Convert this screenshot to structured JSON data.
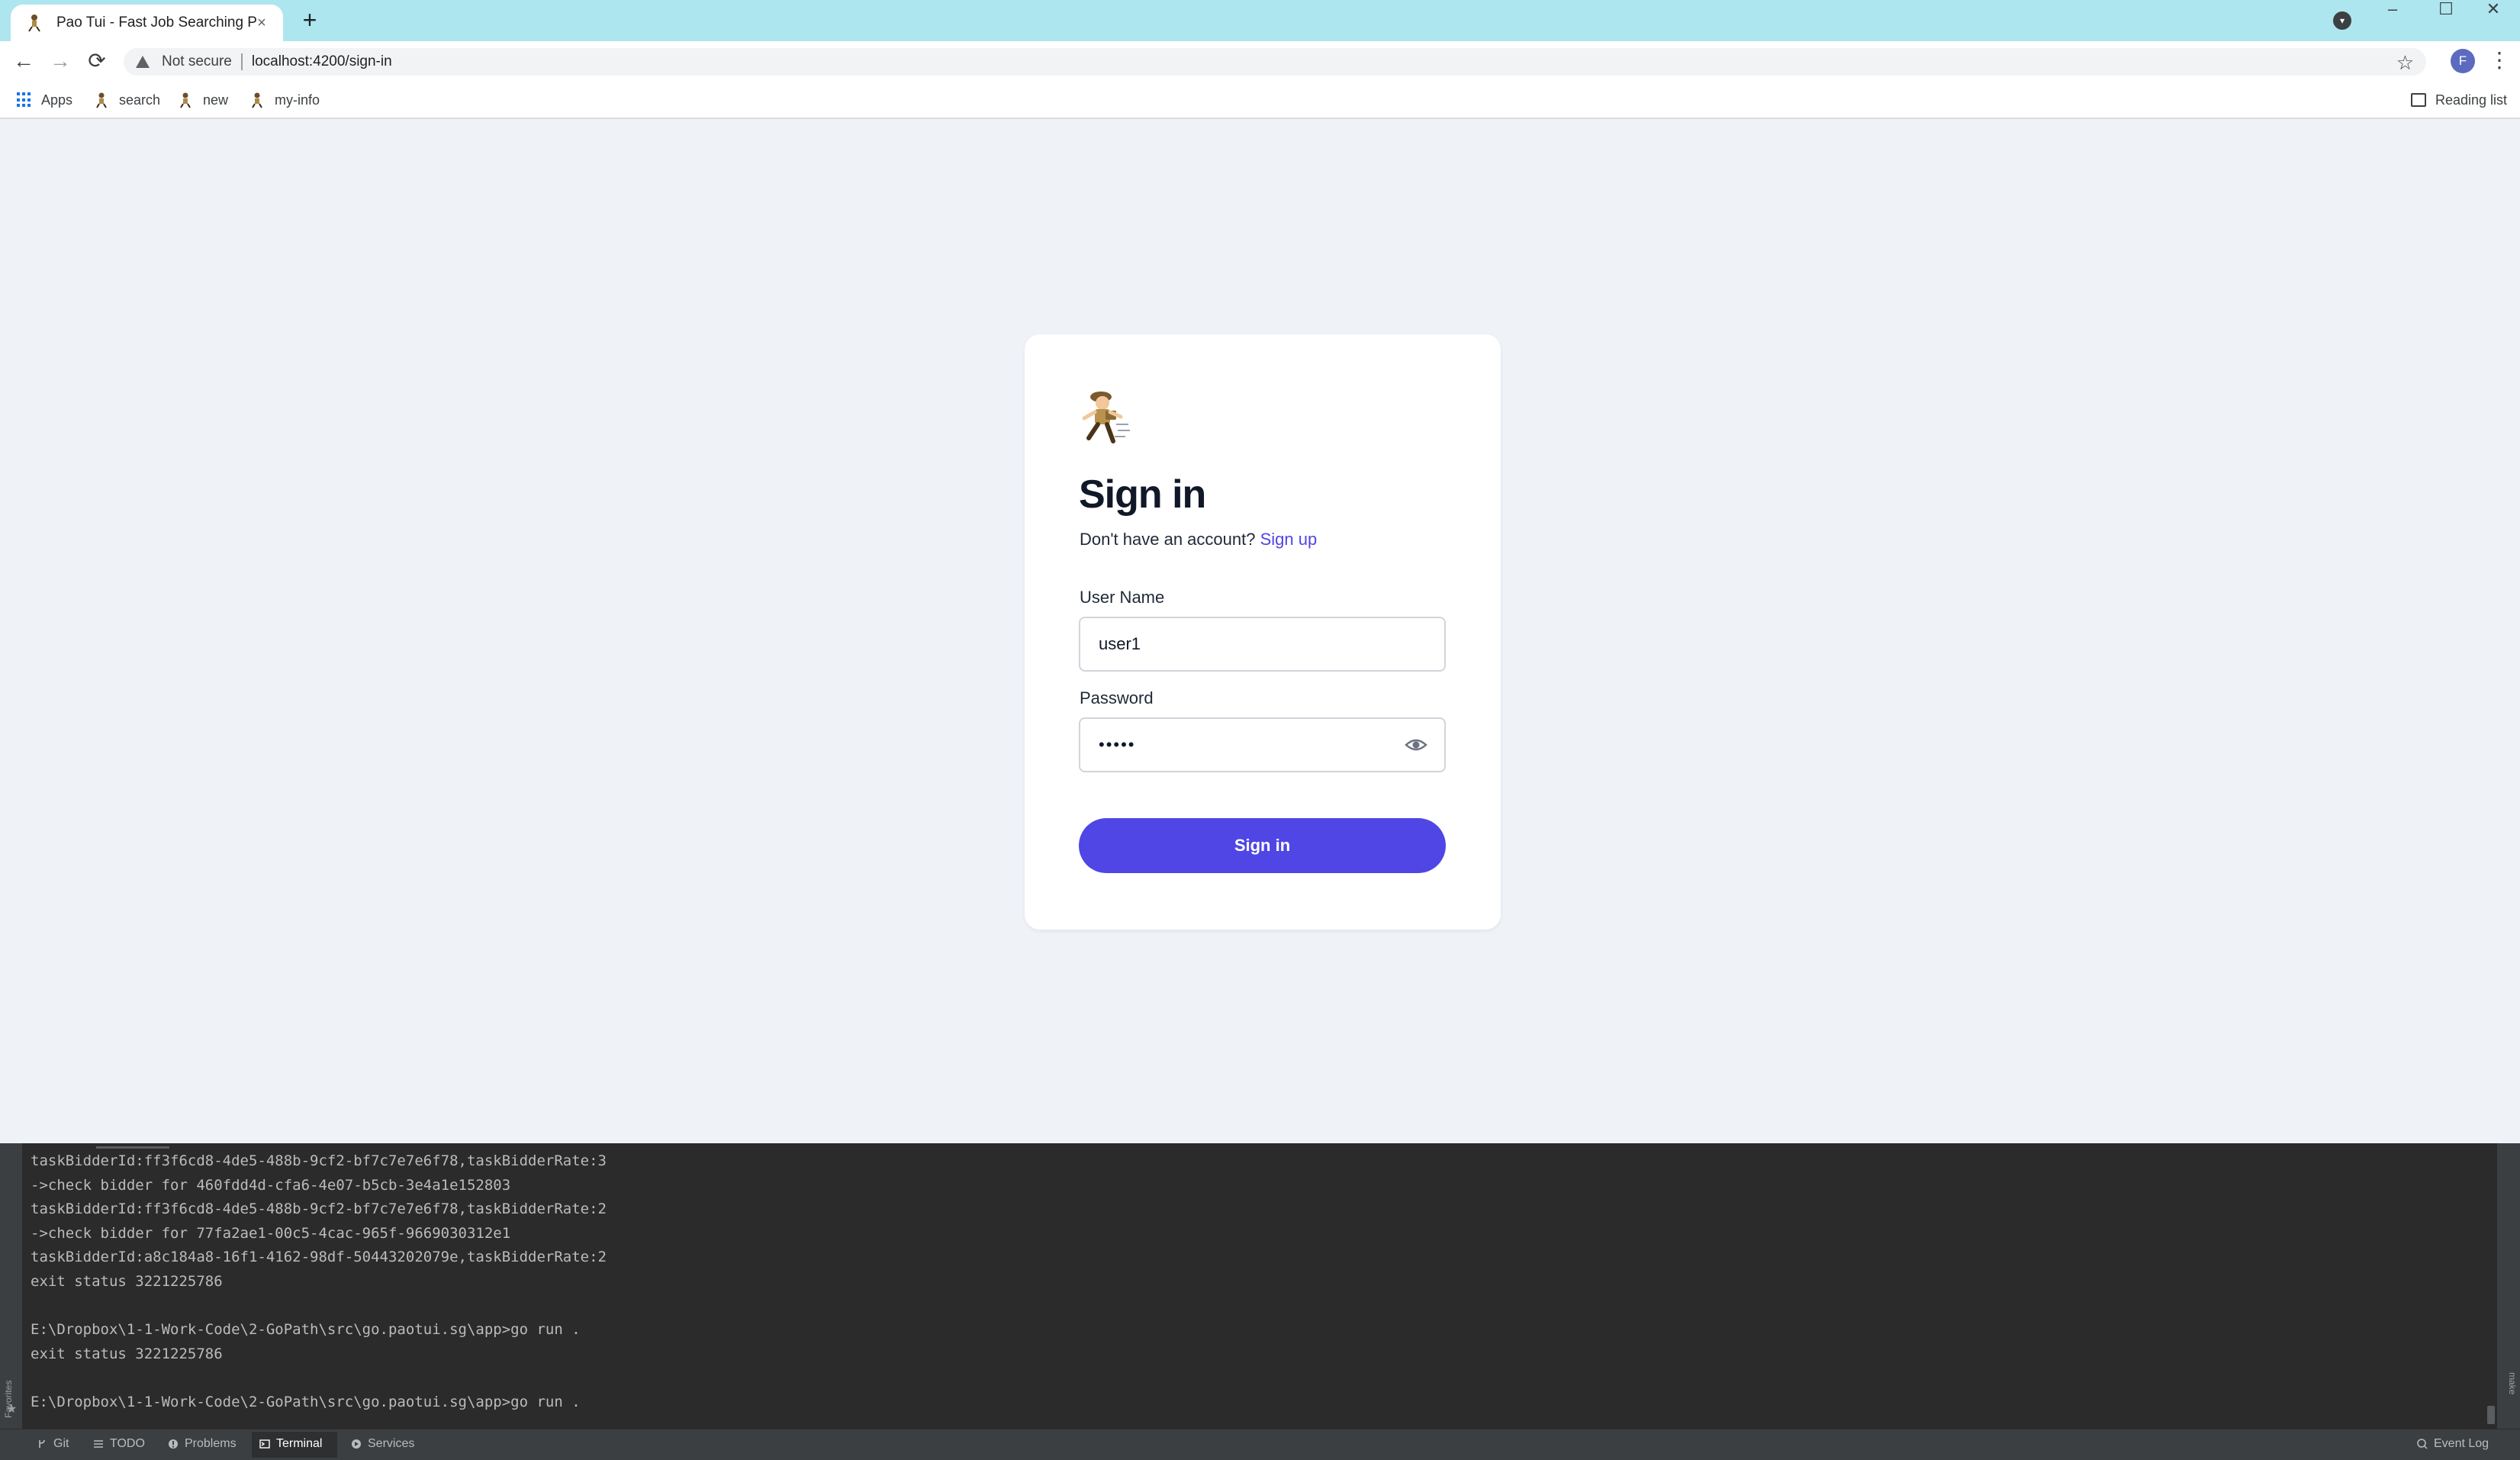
{
  "browser": {
    "tab_title": "Pao Tui - Fast Job Searching Platf",
    "tab_close": "×",
    "new_tab": "+",
    "profile_dropdown": "▾",
    "window_minimize": "–",
    "window_maximize": "☐",
    "window_close": "✕",
    "back": "←",
    "forward": "→",
    "reload": "⟳",
    "security_label": "Not secure",
    "url": "localhost:4200/sign-in",
    "bookmark_star": "☆",
    "avatar_letter": "F",
    "menu": "⋮",
    "bookmarks": [
      {
        "label": "Apps"
      },
      {
        "label": "search"
      },
      {
        "label": "new"
      },
      {
        "label": "my-info"
      }
    ],
    "reading_list": "Reading list"
  },
  "signin": {
    "title": "Sign in",
    "subtitle_prefix": "Don't have an account?",
    "signup_link": "Sign up",
    "username_label": "User Name",
    "username_value": "user1",
    "password_label": "Password",
    "password_value": "•••••",
    "submit_label": "Sign in",
    "accent_color": "#4f46e5"
  },
  "terminal": {
    "lines": [
      "taskBidderId:ff3f6cd8-4de5-488b-9cf2-bf7c7e7e6f78,taskBidderRate:3",
      "->check bidder for 460fdd4d-cfa6-4e07-b5cb-3e4a1e152803",
      "taskBidderId:ff3f6cd8-4de5-488b-9cf2-bf7c7e7e6f78,taskBidderRate:2",
      "->check bidder for 77fa2ae1-00c5-4cac-965f-9669030312e1",
      "taskBidderId:a8c184a8-16f1-4162-98df-50443202079e,taskBidderRate:2",
      "exit status 3221225786",
      "",
      "E:\\Dropbox\\1-1-Work-Code\\2-GoPath\\src\\go.paotui.sg\\app>go run .",
      "exit status 3221225786",
      "",
      "E:\\Dropbox\\1-1-Work-Code\\2-GoPath\\src\\go.paotui.sg\\app>go run ."
    ],
    "favorites_label": "Favorites",
    "make_label": "make"
  },
  "statusbar": {
    "items": [
      {
        "label": "Git"
      },
      {
        "label": "TODO"
      },
      {
        "label": "Problems"
      },
      {
        "label": "Terminal"
      },
      {
        "label": "Services"
      }
    ],
    "event_log": "Event Log"
  }
}
